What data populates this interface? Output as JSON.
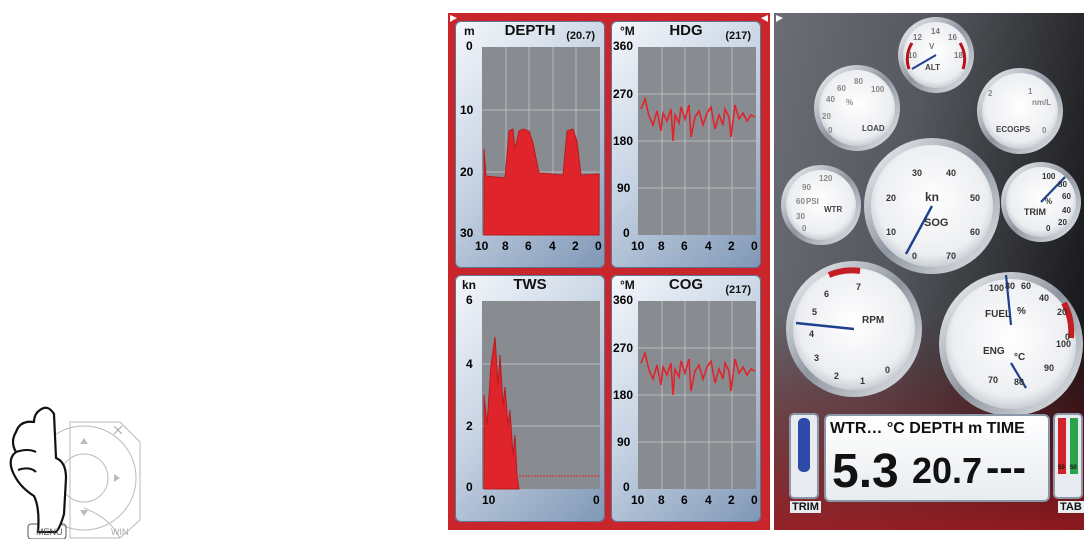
{
  "keypad": {
    "menu_label": "MENU",
    "win_label": "WIN"
  },
  "panels": {
    "depth": {
      "unit": "m",
      "title": "DEPTH",
      "value": "(20.7)",
      "y_ticks": [
        "0",
        "10",
        "20",
        "30"
      ],
      "x_ticks": [
        "10",
        "8",
        "6",
        "4",
        "2",
        "0"
      ]
    },
    "hdg": {
      "unit": "°M",
      "title": "HDG",
      "value": "(217)",
      "y_ticks": [
        "360",
        "270",
        "180",
        "90",
        "0"
      ],
      "x_ticks": [
        "10",
        "8",
        "6",
        "4",
        "2",
        "0"
      ]
    },
    "tws": {
      "unit": "kn",
      "title": "TWS",
      "value": "",
      "y_ticks": [
        "6",
        "4",
        "2",
        "0"
      ],
      "x_ticks": [
        "10",
        "0"
      ]
    },
    "cog": {
      "unit": "°M",
      "title": "COG",
      "value": "(217)",
      "y_ticks": [
        "360",
        "270",
        "180",
        "90",
        "0"
      ],
      "x_ticks": [
        "10",
        "8",
        "6",
        "4",
        "2",
        "0"
      ]
    }
  },
  "gauges": {
    "alt": {
      "label": "ALT",
      "unit": "V",
      "ticks": [
        "10",
        "12",
        "14",
        "16",
        "18"
      ]
    },
    "load": {
      "label": "LOAD",
      "unit": "%",
      "ticks": [
        "0",
        "20",
        "40",
        "60",
        "80",
        "100"
      ]
    },
    "ecogps": {
      "label": "ECOGPS",
      "unit": "nm/L",
      "ticks": [
        "2",
        "1",
        "0"
      ]
    },
    "wtr": {
      "label": "WTR",
      "unit": "PSI",
      "ticks": [
        "0",
        "30",
        "60",
        "90",
        "120"
      ]
    },
    "sog": {
      "label": "SOG",
      "unit": "kn",
      "ticks": [
        "0",
        "10",
        "20",
        "30",
        "40",
        "50",
        "60",
        "70"
      ]
    },
    "trim": {
      "label": "TRIM",
      "unit": "%",
      "ticks": [
        "0",
        "20",
        "40",
        "60",
        "80",
        "100"
      ]
    },
    "rpm": {
      "label": "RPM",
      "ticks": [
        "0",
        "1",
        "2",
        "3",
        "4",
        "5",
        "6",
        "7"
      ]
    },
    "fuel": {
      "label": "FUEL",
      "unit": "%",
      "ticks": [
        "0",
        "20",
        "40",
        "60",
        "80",
        "100"
      ]
    },
    "eng": {
      "label": "ENG",
      "unit": "°C",
      "ticks": [
        "70",
        "80",
        "90",
        "100"
      ]
    }
  },
  "data_bar": {
    "header": "WTR… °C DEPTH  m  TIME",
    "water_temp": "5.3",
    "depth": "20.7",
    "time": "---",
    "trim_label": "TRIM",
    "tab_label": "TAB",
    "tab_left": "50",
    "tab_right": "50"
  },
  "colors": {
    "graph_red": "#e0242b",
    "frame_red": "#c8262b",
    "needle_blue": "#1f3f8f"
  }
}
